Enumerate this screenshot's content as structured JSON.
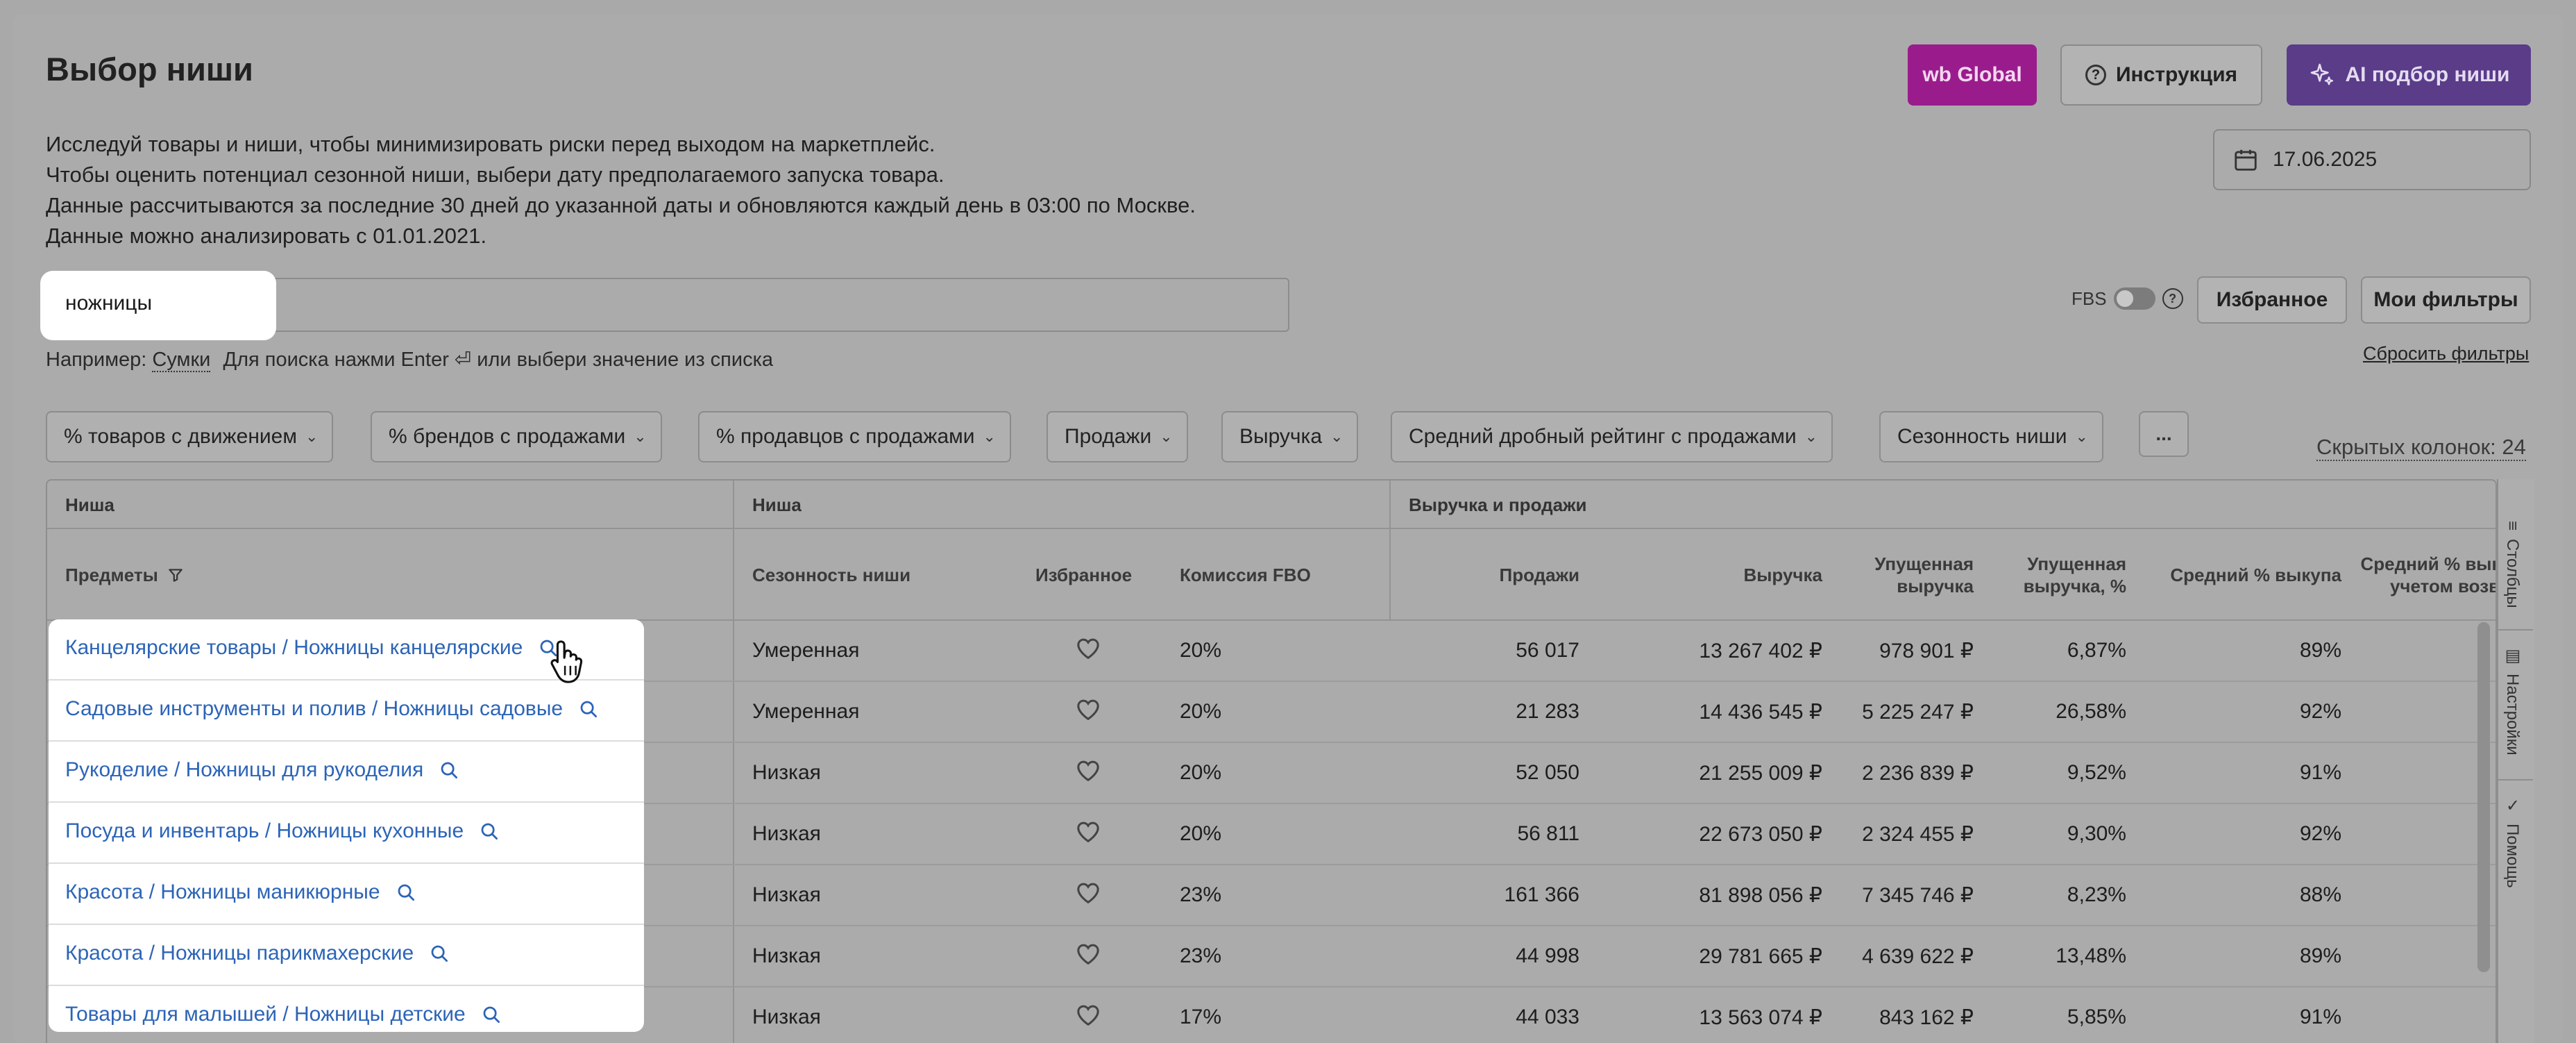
{
  "header": {
    "title": "Выбор ниши",
    "btn_global": "wb Global",
    "btn_instr": "Инструкция",
    "btn_ai": "AI подбор ниши"
  },
  "description": [
    "Исследуй товары и ниши, чтобы минимизировать риски перед выходом на маркетплейс.",
    "Чтобы оценить потенциал сезонной ниши, выбери дату предполагаемого запуска товара.",
    "Данные рассчитываются за последние 30 дней до указанной даты и обновляются каждый день в 03:00 по Москве.",
    "Данные можно анализировать с 01.01.2021."
  ],
  "date": "17.06.2025",
  "search": {
    "value": "ножницы",
    "hint_prefix": "Например:",
    "hint_sample": "Сумки",
    "hint_text": "Для поиска нажми Enter ⏎ или выбери значение из списка"
  },
  "fbs_label": "FBS",
  "buttons": {
    "favorites": "Избранное",
    "my_filters": "Мои фильтры",
    "reset": "Сбросить фильтры"
  },
  "filters": [
    "% товаров с движением",
    "% брендов с продажами",
    "% продавцов с продажами",
    "Продажи",
    "Выручка",
    "Средний дробный рейтинг с продажами",
    "Сезонность ниши"
  ],
  "more_label": "...",
  "hidden_columns": "Скрытых колонок: 24",
  "table": {
    "groups": [
      "Ниша",
      "Ниша",
      "Выручка и продажи"
    ],
    "headers": {
      "subjects": "Предметы",
      "seasonality": "Сезонность ниши",
      "favorite": "Избранное",
      "commission": "Комиссия FBO",
      "sales": "Продажи",
      "revenue": "Выручка",
      "lost_revenue_1": "Упущенная",
      "lost_revenue_2": "выручка",
      "lost_pct_1": "Упущенная",
      "lost_pct_2": "выручка, %",
      "avg_buyout": "Средний % выкупа",
      "avg_buyout_ret_1": "Средний % выку",
      "avg_buyout_ret_2": "учетом возвр"
    },
    "rows": [
      {
        "subject": "Канцелярские товары / Ножницы канцелярские",
        "season": "Умеренная",
        "commission": "20%",
        "sales": "56 017",
        "revenue": "13 267 402 ₽",
        "lost": "978 901 ₽",
        "lost_pct": "6,87%",
        "buyout": "89%"
      },
      {
        "subject": "Садовые инструменты и полив / Ножницы садовые",
        "season": "Умеренная",
        "commission": "20%",
        "sales": "21 283",
        "revenue": "14 436 545 ₽",
        "lost": "5 225 247 ₽",
        "lost_pct": "26,58%",
        "buyout": "92%"
      },
      {
        "subject": "Рукоделие / Ножницы для рукоделия",
        "season": "Низкая",
        "commission": "20%",
        "sales": "52 050",
        "revenue": "21 255 009 ₽",
        "lost": "2 236 839 ₽",
        "lost_pct": "9,52%",
        "buyout": "91%"
      },
      {
        "subject": "Посуда и инвентарь / Ножницы кухонные",
        "season": "Низкая",
        "commission": "20%",
        "sales": "56 811",
        "revenue": "22 673 050 ₽",
        "lost": "2 324 455 ₽",
        "lost_pct": "9,30%",
        "buyout": "92%"
      },
      {
        "subject": "Красота / Ножницы маникюрные",
        "season": "Низкая",
        "commission": "23%",
        "sales": "161 366",
        "revenue": "81 898 056 ₽",
        "lost": "7 345 746 ₽",
        "lost_pct": "8,23%",
        "buyout": "88%"
      },
      {
        "subject": "Красота / Ножницы парикмахерские",
        "season": "Низкая",
        "commission": "23%",
        "sales": "44 998",
        "revenue": "29 781 665 ₽",
        "lost": "4 639 622 ₽",
        "lost_pct": "13,48%",
        "buyout": "89%"
      },
      {
        "subject": "Товары для малышей / Ножницы детские",
        "season": "Низкая",
        "commission": "17%",
        "sales": "44 033",
        "revenue": "13 563 074 ₽",
        "lost": "843 162 ₽",
        "lost_pct": "5,85%",
        "buyout": "91%"
      }
    ]
  },
  "side_tabs": [
    "Столбцы",
    "Настройки",
    "Помощь"
  ]
}
